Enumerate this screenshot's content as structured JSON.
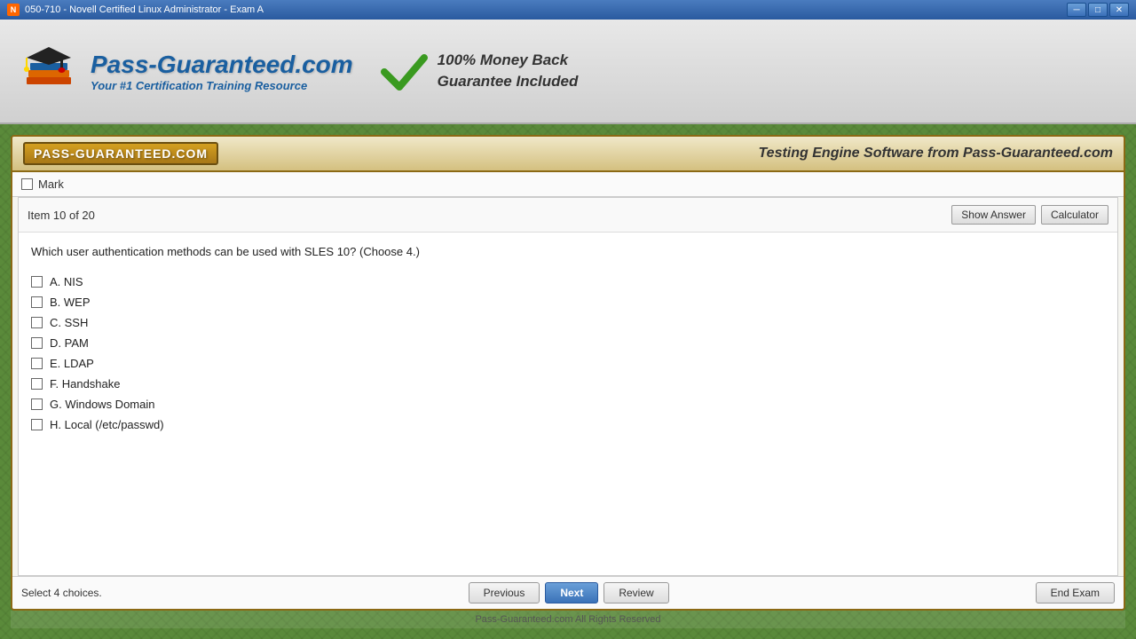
{
  "titleBar": {
    "title": "050-710 - Novell Certified Linux Administrator - Exam A",
    "minBtn": "─",
    "maxBtn": "□",
    "closeBtn": "✕"
  },
  "header": {
    "brandName": "Pass-Guaranteed.com",
    "brandTagline": "Your #1 Certification Training Resource",
    "guaranteeText": "100% Money Back\nGuarantee Included"
  },
  "brandBar": {
    "logoText": "PASS-GUARANTEED.COM",
    "testingEngineText": "Testing Engine Software from Pass-Guaranteed.com"
  },
  "markRow": {
    "label": "Mark"
  },
  "itemHeader": {
    "itemNumber": "Item 10 of 20",
    "showAnswerLabel": "Show Answer",
    "calculatorLabel": "Calculator"
  },
  "question": {
    "text": "Which user authentication methods can be used with SLES 10? (Choose 4.)"
  },
  "options": [
    {
      "id": "A",
      "label": "NIS",
      "checked": false
    },
    {
      "id": "B",
      "label": "WEP",
      "checked": false
    },
    {
      "id": "C",
      "label": "SSH",
      "checked": false
    },
    {
      "id": "D",
      "label": "PAM",
      "checked": false
    },
    {
      "id": "E",
      "label": "LDAP",
      "checked": false
    },
    {
      "id": "F",
      "label": "Handshake",
      "checked": false
    },
    {
      "id": "G",
      "label": "Windows Domain",
      "checked": false
    },
    {
      "id": "H",
      "label": "Local (/etc/passwd)",
      "checked": false
    }
  ],
  "bottomBar": {
    "selectHint": "Select 4 choices.",
    "prevLabel": "Previous",
    "nextLabel": "Next",
    "reviewLabel": "Review",
    "endExamLabel": "End Exam"
  },
  "footer": {
    "text": "Pass-Guaranteed.com All Rights Reserved"
  }
}
